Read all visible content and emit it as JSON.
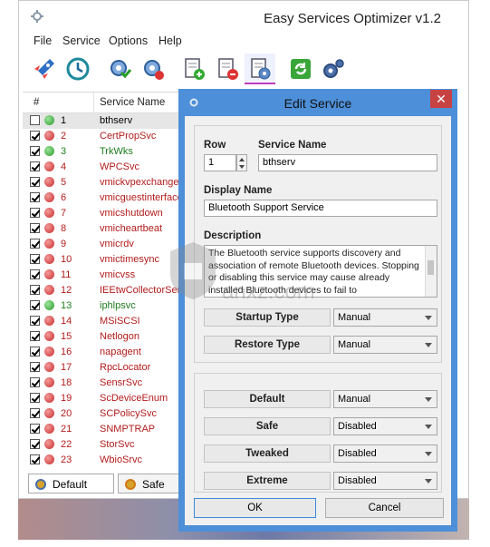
{
  "window": {
    "title": "Easy Services Optimizer v1.2"
  },
  "menu": [
    "File",
    "Service",
    "Options",
    "Help"
  ],
  "toolbar": {
    "icons": [
      "rocket-icon",
      "restore-clock-icon",
      "gear-blue-icon",
      "gear-red-icon",
      "doc-add-icon",
      "doc-remove-icon",
      "doc-edit-icon",
      "refresh-icon",
      "settings-icon"
    ],
    "active_index": 6
  },
  "list": {
    "columns": [
      "#",
      "Service Name"
    ],
    "rows": [
      {
        "num": "1",
        "name": "bthserv",
        "checked": false,
        "status": "green",
        "color": "#000000"
      },
      {
        "num": "2",
        "name": "CertPropSvc",
        "checked": true,
        "status": "red",
        "color": "#b31b1b"
      },
      {
        "num": "3",
        "name": "TrkWks",
        "checked": true,
        "status": "green",
        "color": "#1e7d1e"
      },
      {
        "num": "4",
        "name": "WPCSvc",
        "checked": true,
        "status": "red",
        "color": "#b31b1b"
      },
      {
        "num": "5",
        "name": "vmickvpexchange",
        "checked": true,
        "status": "red",
        "color": "#b31b1b"
      },
      {
        "num": "6",
        "name": "vmicguestinterface",
        "checked": true,
        "status": "red",
        "color": "#b31b1b"
      },
      {
        "num": "7",
        "name": "vmicshutdown",
        "checked": true,
        "status": "red",
        "color": "#b31b1b"
      },
      {
        "num": "8",
        "name": "vmicheartbeat",
        "checked": true,
        "status": "red",
        "color": "#b31b1b"
      },
      {
        "num": "9",
        "name": "vmicrdv",
        "checked": true,
        "status": "red",
        "color": "#b31b1b"
      },
      {
        "num": "10",
        "name": "vmictimesync",
        "checked": true,
        "status": "red",
        "color": "#b31b1b"
      },
      {
        "num": "11",
        "name": "vmicvss",
        "checked": true,
        "status": "red",
        "color": "#b31b1b"
      },
      {
        "num": "12",
        "name": "IEEtwCollectorService",
        "checked": true,
        "status": "red",
        "color": "#b31b1b"
      },
      {
        "num": "13",
        "name": "iphlpsvc",
        "checked": true,
        "status": "green",
        "color": "#1e7d1e"
      },
      {
        "num": "14",
        "name": "MSiSCSI",
        "checked": true,
        "status": "red",
        "color": "#b31b1b"
      },
      {
        "num": "15",
        "name": "Netlogon",
        "checked": true,
        "status": "red",
        "color": "#b31b1b"
      },
      {
        "num": "16",
        "name": "napagent",
        "checked": true,
        "status": "red",
        "color": "#b31b1b"
      },
      {
        "num": "17",
        "name": "RpcLocator",
        "checked": true,
        "status": "red",
        "color": "#b31b1b"
      },
      {
        "num": "18",
        "name": "SensrSvc",
        "checked": true,
        "status": "red",
        "color": "#b31b1b"
      },
      {
        "num": "19",
        "name": "ScDeviceEnum",
        "checked": true,
        "status": "red",
        "color": "#b31b1b"
      },
      {
        "num": "20",
        "name": "SCPolicySvc",
        "checked": true,
        "status": "red",
        "color": "#b31b1b"
      },
      {
        "num": "21",
        "name": "SNMPTRAP",
        "checked": true,
        "status": "red",
        "color": "#b31b1b"
      },
      {
        "num": "22",
        "name": "StorSvc",
        "checked": true,
        "status": "red",
        "color": "#b31b1b"
      },
      {
        "num": "23",
        "name": "WbioSrvc",
        "checked": true,
        "status": "red",
        "color": "#b31b1b"
      }
    ]
  },
  "bottom_tabs": [
    "Default",
    "Safe"
  ],
  "dialog": {
    "title": "Edit Service",
    "row_label": "Row",
    "row_value": "1",
    "service_name_label": "Service Name",
    "service_name_value": "bthserv",
    "display_name_label": "Display Name",
    "display_name_value": "Bluetooth Support Service",
    "description_label": "Description",
    "description_value": "The Bluetooth service supports discovery and association of remote Bluetooth devices. Stopping or disabling this service may cause already installed Bluetooth devices to fail to",
    "startup_type_label": "Startup Type",
    "startup_type_value": "Manual",
    "restore_type_label": "Restore Type",
    "restore_type_value": "Manual",
    "default_label": "Default",
    "default_value": "Manual",
    "safe_label": "Safe",
    "safe_value": "Disabled",
    "tweaked_label": "Tweaked",
    "tweaked_value": "Disabled",
    "extreme_label": "Extreme",
    "extreme_value": "Disabled",
    "ok_label": "OK",
    "cancel_label": "Cancel",
    "close_glyph": "✕"
  },
  "watermark": "anxz.com",
  "colors": {
    "accent": "#4d8fd8",
    "close": "#c74343",
    "active_tab": "#c23ac0"
  }
}
